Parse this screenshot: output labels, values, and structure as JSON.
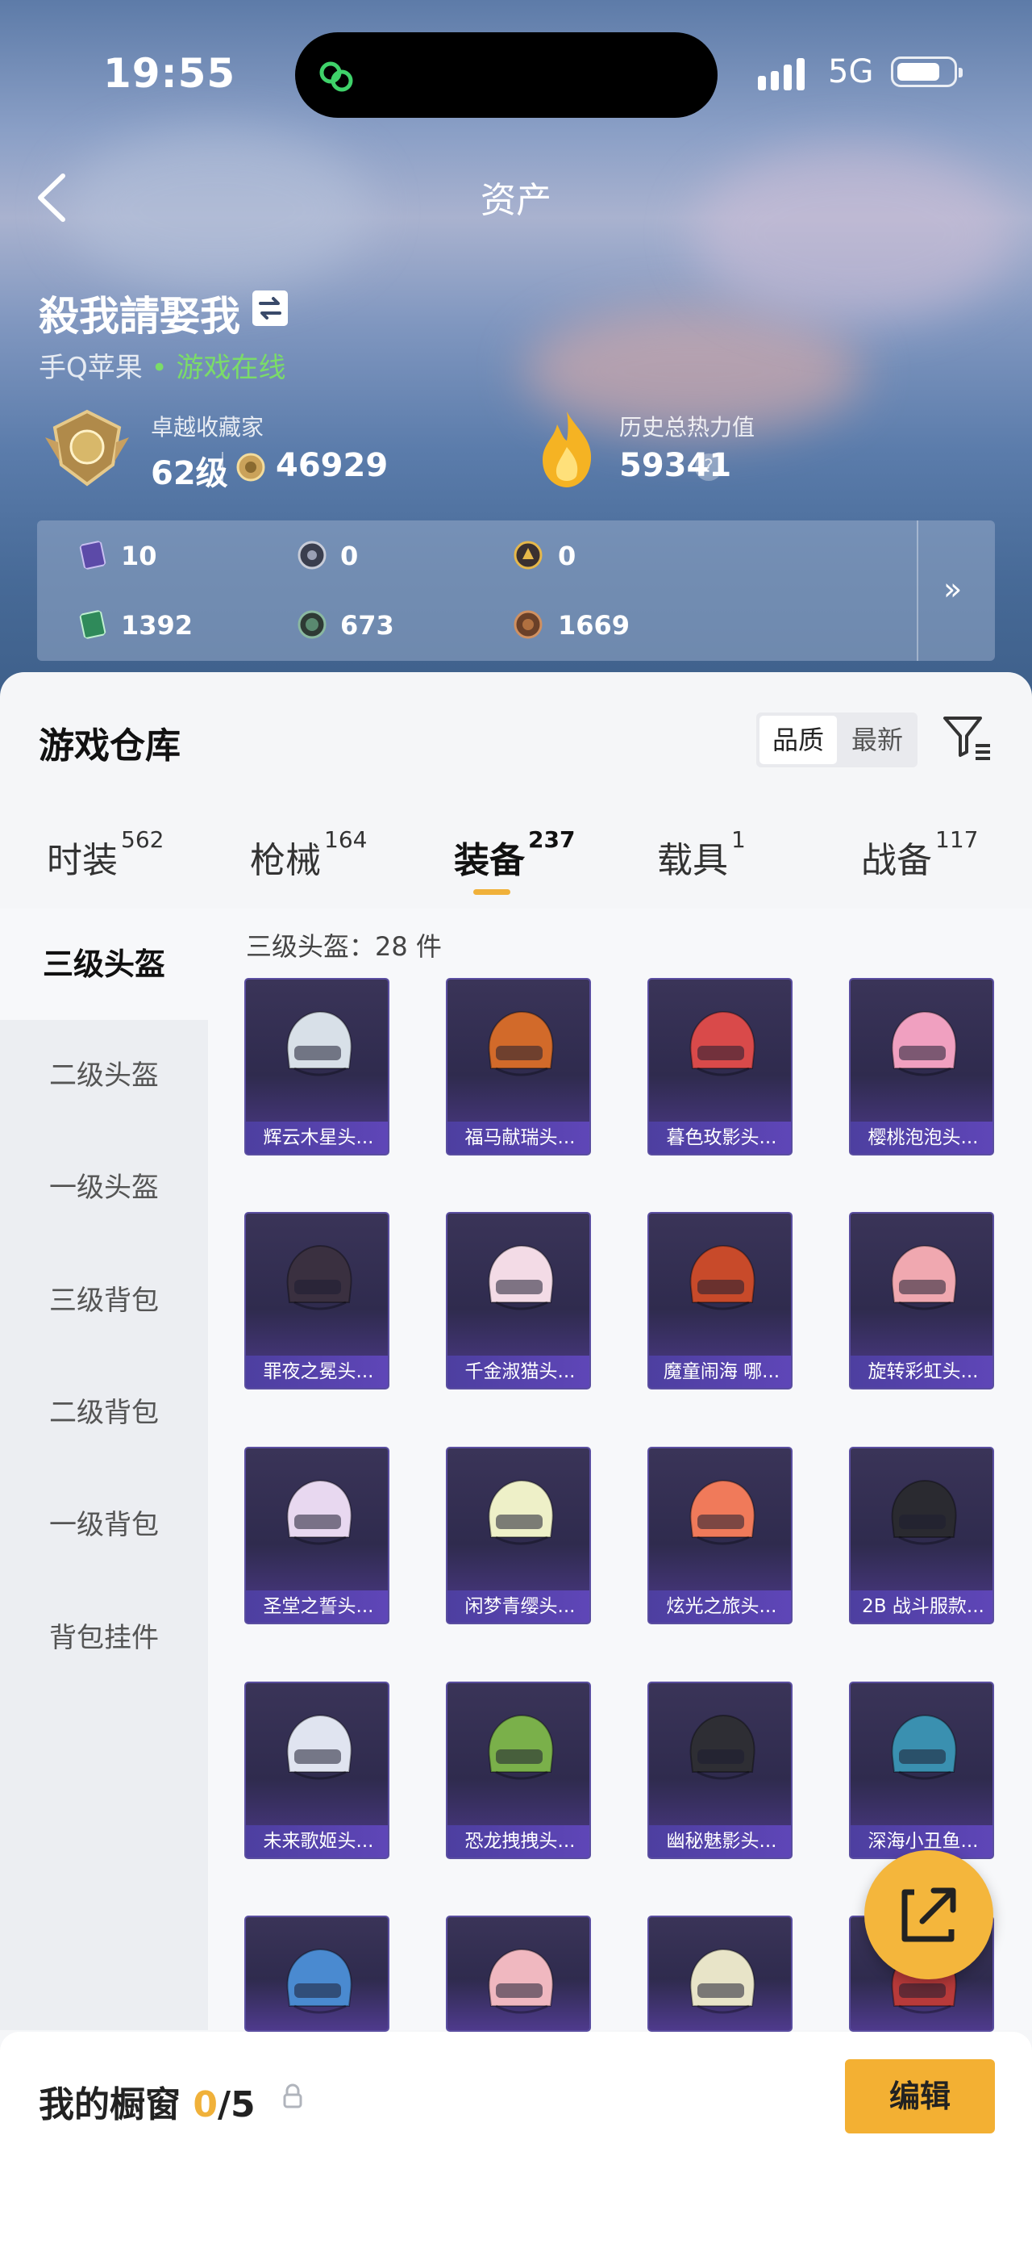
{
  "status_bar": {
    "time": "19:55",
    "network": "5G"
  },
  "header": {
    "title": "资产"
  },
  "profile": {
    "username": "殺我請娶我",
    "platform": "手Q苹果",
    "online_status": "• 游戏在线",
    "collector_label": "卓越收藏家",
    "level": "62级",
    "points": "46929",
    "heat_label": "历史总热力值",
    "heat_value": "59341"
  },
  "resources": [
    {
      "icon": "purple-card-icon",
      "value": "10"
    },
    {
      "icon": "silver-coin-icon",
      "value": "0"
    },
    {
      "icon": "gold-coin-icon",
      "value": "0"
    },
    {
      "icon": "green-card-icon",
      "value": "1392"
    },
    {
      "icon": "green-orb-icon",
      "value": "673"
    },
    {
      "icon": "bronze-coin-icon",
      "value": "1669"
    }
  ],
  "warehouse": {
    "title": "游戏仓库",
    "sort_quality": "品质",
    "sort_newest": "最新",
    "tabs": [
      {
        "label": "时装",
        "count": "562"
      },
      {
        "label": "枪械",
        "count": "164"
      },
      {
        "label": "装备",
        "count": "237"
      },
      {
        "label": "载具",
        "count": "1"
      },
      {
        "label": "战备",
        "count": "117"
      }
    ],
    "categories": [
      "三级头盔",
      "二级头盔",
      "一级头盔",
      "三级背包",
      "二级背包",
      "一级背包",
      "背包挂件"
    ],
    "count_text": "三级头盔：28 件",
    "items": [
      {
        "name": "辉云木星头...",
        "color": "#d8e0e8"
      },
      {
        "name": "福马献瑞头...",
        "color": "#d26a2a"
      },
      {
        "name": "暮色玫影头...",
        "color": "#d94a4a"
      },
      {
        "name": "樱桃泡泡头...",
        "color": "#f0a0c0"
      },
      {
        "name": "罪夜之冕头...",
        "color": "#3a3040"
      },
      {
        "name": "千金淑猫头...",
        "color": "#f3dbe6"
      },
      {
        "name": "魔童闹海 哪...",
        "color": "#c84a2a"
      },
      {
        "name": "旋转彩虹头...",
        "color": "#f0a8b0"
      },
      {
        "name": "圣堂之誓头...",
        "color": "#e8d8f0"
      },
      {
        "name": "闲梦青缨头...",
        "color": "#eef0c8"
      },
      {
        "name": "炫光之旅头...",
        "color": "#f07a5a"
      },
      {
        "name": "2B 战斗服款...",
        "color": "#2a2a30"
      },
      {
        "name": "未来歌姬头...",
        "color": "#e0e4f0"
      },
      {
        "name": "恐龙拽拽头...",
        "color": "#7ab04a"
      },
      {
        "name": "幽秘魅影头...",
        "color": "#2e2e34"
      },
      {
        "name": "深海小丑鱼...",
        "color": "#3a90b0"
      },
      {
        "name": "",
        "color": "#4a8ad0"
      },
      {
        "name": "",
        "color": "#f0b8c0"
      },
      {
        "name": "",
        "color": "#e8e4c8"
      },
      {
        "name": "",
        "color": "#b83a3a"
      }
    ]
  },
  "showcase": {
    "title": "我的橱窗",
    "current": "0",
    "total": "/5",
    "edit_label": "编辑"
  },
  "colors": {
    "accent": "#f0b13a",
    "online": "#7bdc68"
  }
}
